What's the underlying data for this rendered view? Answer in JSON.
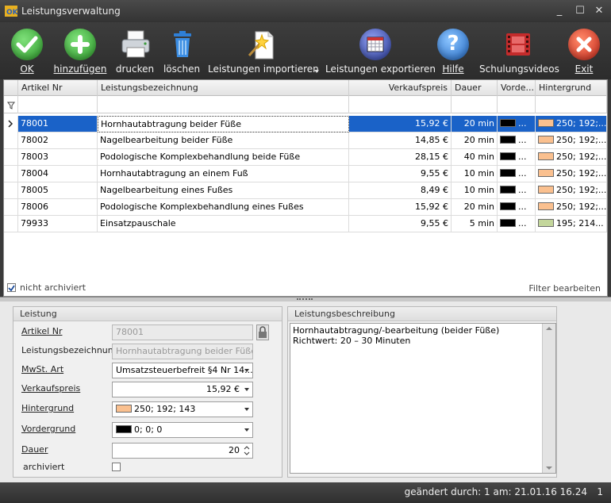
{
  "window": {
    "title": "Leistungsverwaltung",
    "app_icon": "ok-app-icon",
    "controls": [
      "_",
      "☐",
      "✕"
    ]
  },
  "toolbar": {
    "buttons": [
      {
        "label": "OK",
        "icon": "checkmark-icon",
        "color": "#3bb23a"
      },
      {
        "label": "hinzufügen",
        "icon": "plus-icon",
        "color": "#3bb23a"
      },
      {
        "label": "drucken",
        "icon": "printer-icon"
      },
      {
        "label": "löschen",
        "icon": "trash-icon",
        "color": "#2f7fd6"
      },
      {
        "label": "Leistungen importieren",
        "icon": "import-wand-icon"
      },
      {
        "label": "Leistungen exportieren",
        "icon": "calendar-export-icon",
        "color": "#3a4fb5"
      },
      {
        "label": "Hilfe",
        "icon": "help-icon",
        "color": "#2f7fd6"
      },
      {
        "label": "Schulungsvideos",
        "icon": "film-icon",
        "color": "#c42b2b"
      },
      {
        "label": "Exit",
        "icon": "close-icon",
        "color": "#d6402a"
      }
    ]
  },
  "grid": {
    "columns": [
      "Artikel Nr",
      "Leistungsbezeichnung",
      "Verkaufspreis",
      "Dauer",
      "Vorde...",
      "Hintergrund"
    ],
    "rows": [
      {
        "nr": "78001",
        "name": "Hornhautabtragung beider Füße",
        "price": "15,92 €",
        "dauer": "20 min",
        "fg": "#000000",
        "bg_color": "#fac08f",
        "bg_text": "250; 192;..."
      },
      {
        "nr": "78002",
        "name": "Nagelbearbeitung beider Füße",
        "price": "14,85 €",
        "dauer": "20 min",
        "fg": "#000000",
        "bg_color": "#fac08f",
        "bg_text": "250; 192;..."
      },
      {
        "nr": "78003",
        "name": "Podologische Komplexbehandlung beide Füße",
        "price": "28,15 €",
        "dauer": "40 min",
        "fg": "#000000",
        "bg_color": "#fac08f",
        "bg_text": "250; 192;..."
      },
      {
        "nr": "78004",
        "name": "Hornhautabtragung an einem Fuß",
        "price": "9,55 €",
        "dauer": "10 min",
        "fg": "#000000",
        "bg_color": "#fac08f",
        "bg_text": "250; 192;..."
      },
      {
        "nr": "78005",
        "name": "Nagelbearbeitung eines Fußes",
        "price": "8,49 €",
        "dauer": "10 min",
        "fg": "#000000",
        "bg_color": "#fac08f",
        "bg_text": "250; 192;..."
      },
      {
        "nr": "78006",
        "name": "Podologische Komplexbehandlung eines Fußes",
        "price": "15,92 €",
        "dauer": "20 min",
        "fg": "#000000",
        "bg_color": "#fac08f",
        "bg_text": "250; 192;..."
      },
      {
        "nr": "79933",
        "name": "Einsatzpauschale",
        "price": "9,55 €",
        "dauer": "5 min",
        "fg": "#000000",
        "bg_color": "#c3d69b",
        "bg_text": "195; 214..."
      }
    ],
    "selected_row": 0,
    "footer_checkbox_label": "nicht archiviert",
    "footer_checkbox_checked": true,
    "footer_link": "Filter bearbeiten"
  },
  "leistung": {
    "group_title": "Leistung",
    "labels": {
      "artikel_nr": "Artikel Nr",
      "bezeichnung": "Leistungsbezeichnung",
      "mwst": "MwSt. Art",
      "verkaufspreis": "Verkaufspreis",
      "hintergrund": "Hintergrund",
      "vordergrund": "Vordergrund",
      "dauer": "Dauer",
      "archiviert": "archiviert"
    },
    "values": {
      "artikel_nr": "78001",
      "bezeichnung": "Hornhautabtragung beider Füße",
      "mwst": "Umsatzsteuerbefreit §4 Nr 14...",
      "verkaufspreis": "15,92 €",
      "hintergrund": "250; 192; 143",
      "hintergrund_color": "#fac08f",
      "vordergrund": "0; 0; 0",
      "vordergrund_color": "#000000",
      "dauer": "20",
      "archiviert": false
    }
  },
  "beschreibung": {
    "group_title": "Leistungsbeschreibung",
    "line1": "Hornhautabtragung/-bearbeitung (beider Füße)",
    "line2": "Richtwert: 20 – 30 Minuten"
  },
  "status": {
    "text": "geändert durch: 1 am: 21.01.16 16.24",
    "count": "1"
  }
}
